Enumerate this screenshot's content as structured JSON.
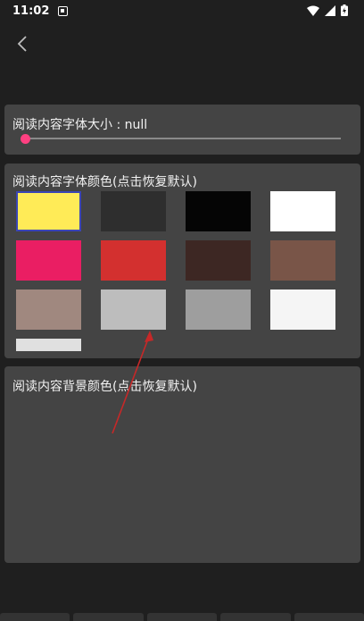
{
  "status_bar": {
    "time": "11:02"
  },
  "font_size": {
    "title": "阅读内容字体大小 : null",
    "slider_value": 0
  },
  "font_color": {
    "title": "阅读内容字体颜色(点击恢复默认)",
    "swatches": [
      {
        "color": "#ffeb57",
        "selected": true
      },
      {
        "color": "#2e2e2e"
      },
      {
        "color": "#050505"
      },
      {
        "color": "#ffffff"
      },
      {
        "color": "#ea1e63"
      },
      {
        "color": "#d3302f"
      },
      {
        "color": "#3d2723"
      },
      {
        "color": "#795548"
      },
      {
        "color": "#a0887f"
      },
      {
        "color": "#bdbdbd"
      },
      {
        "color": "#9e9e9e"
      },
      {
        "color": "#f5f5f5"
      },
      {
        "color": "#e0e0e0"
      }
    ]
  },
  "bg_color": {
    "title": "阅读内容背景颜色(点击恢复默认)"
  }
}
